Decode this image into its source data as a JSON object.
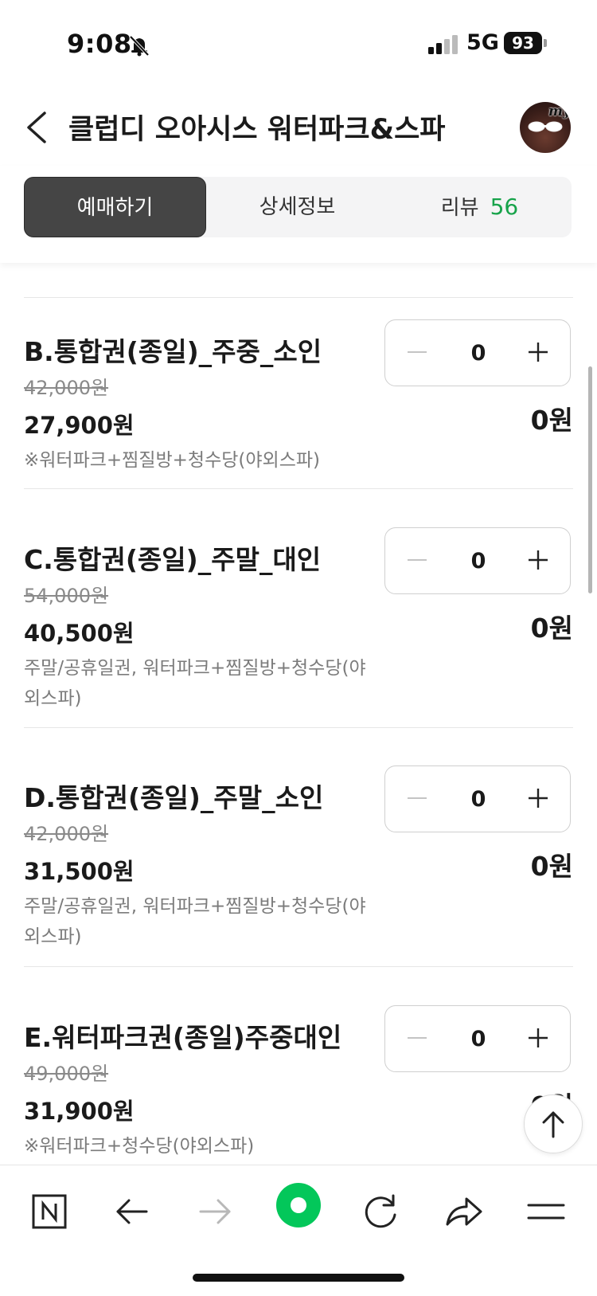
{
  "status_bar": {
    "time": "9:08",
    "network": "5G",
    "battery": "93"
  },
  "header": {
    "title": "클럽디 오아시스 워터파크&스파",
    "avatar_text": "my"
  },
  "tabs": [
    {
      "label": "예매하기",
      "active": true
    },
    {
      "label": "상세정보",
      "active": false
    },
    {
      "label": "리뷰",
      "count": "56",
      "active": false
    }
  ],
  "items": [
    {
      "name": "B.통합권(종일)_주중_소인",
      "original_price": "42,000원",
      "price": "27,900원",
      "description": "※워터파크+찜질방+청수당(야외스파)",
      "quantity": "0",
      "total": "0원"
    },
    {
      "name": "C.통합권(종일)_주말_대인",
      "original_price": "54,000원",
      "price": "40,500원",
      "description": "주말/공휴일권, 워터파크+찜질방+청수당(야외스파)",
      "quantity": "0",
      "total": "0원"
    },
    {
      "name": "D.통합권(종일)_주말_소인",
      "original_price": "42,000원",
      "price": "31,500원",
      "description": "주말/공휴일권, 워터파크+찜질방+청수당(야외스파)",
      "quantity": "0",
      "total": "0원"
    },
    {
      "name": "E.워터파크권(종일)주중대인",
      "original_price": "49,000원",
      "price": "31,900원",
      "description": "※워터파크+청수당(야외스파)",
      "quantity": "0",
      "total": "0원"
    }
  ],
  "colors": {
    "accent_green": "#17a34a",
    "active_tab": "#454545",
    "naver_green": "#03c75a"
  },
  "icons": {
    "back": "chevron-left-icon",
    "bell_muted": "bell-slash-icon",
    "minus": "minus-icon",
    "plus": "plus-icon",
    "scroll_top": "arrow-up-icon",
    "nav": [
      "naver-n-icon",
      "arrow-left-icon",
      "arrow-right-icon",
      "green-dot-icon",
      "refresh-icon",
      "share-icon",
      "menu-icon"
    ]
  }
}
